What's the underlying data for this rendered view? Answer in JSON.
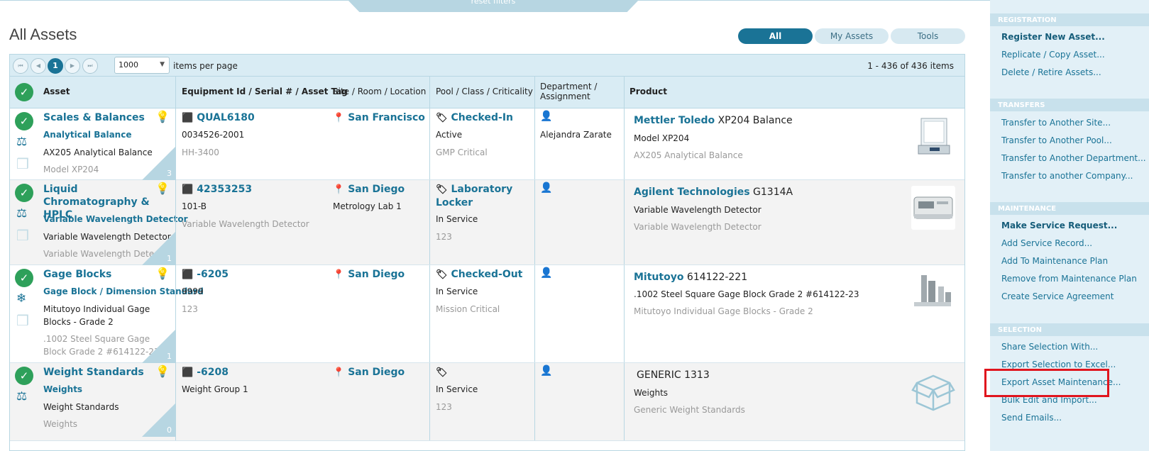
{
  "top": {
    "reset_filters": "reset filters",
    "title": "All Assets"
  },
  "toggles": [
    "All",
    "My Assets",
    "Tools"
  ],
  "pager": {
    "current_page": "1",
    "page_size": "1000",
    "per_page_label": "items per page",
    "range": "1 - 436 of 436 items",
    "first": "⏮",
    "prev": "◀",
    "next": "▶",
    "last": "⏭"
  },
  "columns": [
    "Asset",
    "Equipment Id / Serial # / Asset Tag",
    "Site / Room / Location",
    "Pool / Class / Criticality",
    "Department / Assignment",
    "Product"
  ],
  "rows": [
    {
      "asset_name": "Scales & Balances",
      "asset_class": "Analytical Balance",
      "asset_desc": "AX205 Analytical Balance",
      "asset_model": "Model XP204",
      "count": "3",
      "equip_id": "QUAL6180",
      "serial": "0034526-2001",
      "tag": "HH-3400",
      "site": "San Francisco",
      "room": "",
      "pool": "Checked-In",
      "status": "Active",
      "criticality": "GMP Critical",
      "assignment": "Alejandra Zarate",
      "manufacturer": "Mettler Toledo",
      "product_model": "XP204 Balance",
      "product_line2": "Model XP204",
      "product_line3": "AX205 Analytical Balance"
    },
    {
      "asset_name": "Liquid Chromatography & HPLC",
      "asset_class": "Variable Wavelength Detector",
      "asset_desc": "Variable Wavelength Detector",
      "asset_model": "Variable Wavelength Detector",
      "count": "1",
      "equip_id": "42353253",
      "serial": "101-B",
      "tag": "Variable Wavelength Detector",
      "site": "San Diego",
      "room": "Metrology Lab 1",
      "pool": "Laboratory Locker",
      "status": "In Service",
      "criticality": "123",
      "assignment": "",
      "manufacturer": "Agilent Technologies",
      "product_model": "G1314A",
      "product_line2": "Variable Wavelength Detector",
      "product_line3": "Variable Wavelength Detector"
    },
    {
      "asset_name": "Gage Blocks",
      "asset_class": "Gage Block / Dimension Standard",
      "asset_desc": "Mitutoyo Individual Gage Blocks - Grade 2",
      "asset_model": ".1002 Steel Square Gage Block Grade 2 #614122-23",
      "count": "1",
      "equip_id": "-6205",
      "serial": "9999",
      "tag": "123",
      "site": "San Diego",
      "room": "",
      "pool": "Checked-Out",
      "status": "In Service",
      "criticality": "Mission Critical",
      "assignment": "",
      "manufacturer": "Mitutoyo",
      "product_model": "614122-221",
      "product_line2": ".1002 Steel Square Gage Block Grade 2 #614122-23",
      "product_line3": "Mitutoyo Individual Gage Blocks - Grade 2"
    },
    {
      "asset_name": "Weight Standards",
      "asset_class": "Weights",
      "asset_desc": "Weight Standards",
      "asset_model": "Weights",
      "count": "0",
      "equip_id": "-6208",
      "serial": "Weight Group 1",
      "tag": "",
      "site": "San Diego",
      "room": "",
      "pool": "",
      "status": "In Service",
      "criticality": "123",
      "assignment": "",
      "manufacturer": "",
      "product_model": "GENERIC 1313",
      "product_line2": "Weights",
      "product_line3": "Generic Weight Standards"
    }
  ],
  "sidebar": {
    "registration": {
      "header": "REGISTRATION",
      "items": [
        "Register New Asset...",
        "Replicate / Copy Asset...",
        "Delete / Retire Assets..."
      ]
    },
    "transfers": {
      "header": "TRANSFERS",
      "items": [
        "Transfer to Another Site...",
        "Transfer to Another Pool...",
        "Transfer to Another Department...",
        "Transfer to another Company..."
      ]
    },
    "maintenance": {
      "header": "MAINTENANCE",
      "items": [
        "Make Service Request...",
        "Add Service Record...",
        "Add To Maintenance Plan",
        "Remove from Maintenance Plan",
        "Create Service Agreement"
      ]
    },
    "selection": {
      "header": "SELECTION",
      "items": [
        "Share Selection With...",
        "Export Selection to Excel...",
        "Export Asset Maintenance...",
        "Bulk Edit and Import...",
        "Send Emails..."
      ]
    }
  },
  "colors": {
    "accent": "#1a7396",
    "check": "#2ea05a",
    "highlight": "#e0151e"
  }
}
